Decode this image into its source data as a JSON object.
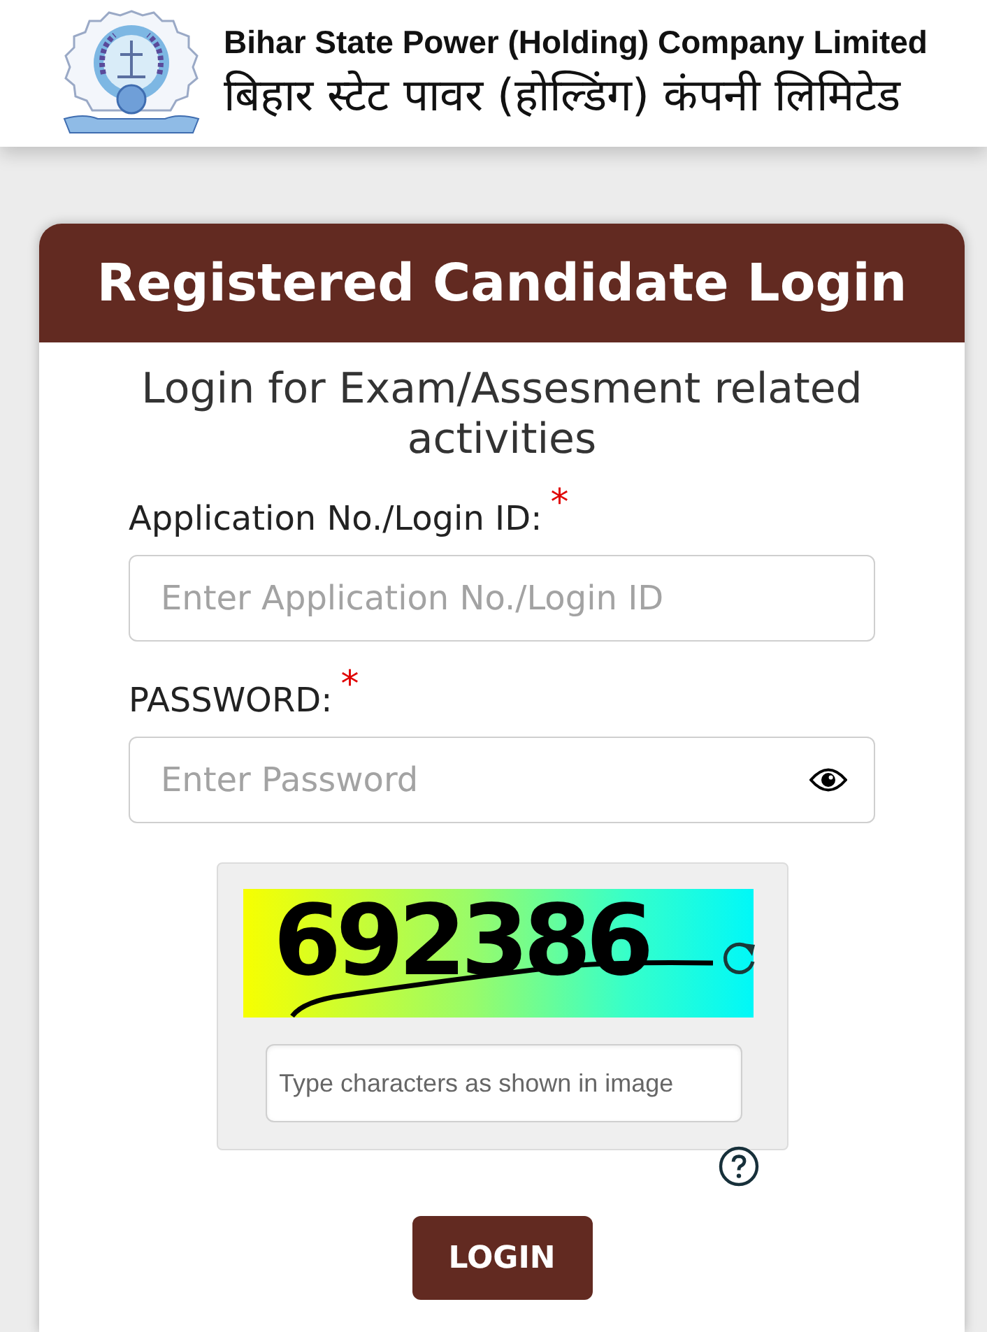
{
  "header": {
    "title": "Bihar State Power (Holding) Company Limited",
    "title_hindi": "बिहार स्टेट पावर (होल्डिंग) कंपनी लिमिटेड"
  },
  "login_card": {
    "title": "Registered Candidate Login",
    "subtitle": "Login for Exam/Assesment related activities",
    "fields": [
      {
        "kind": "text",
        "label": "Application No./Login ID:",
        "required_mark": "*",
        "placeholder": "Enter Application No./Login ID"
      },
      {
        "kind": "password",
        "label": "PASSWORD:",
        "required_mark": "*",
        "placeholder": "Enter Password"
      }
    ],
    "captcha": {
      "code": "692386",
      "placeholder": "Type characters as shown in image"
    },
    "button": "LOGIN"
  }
}
